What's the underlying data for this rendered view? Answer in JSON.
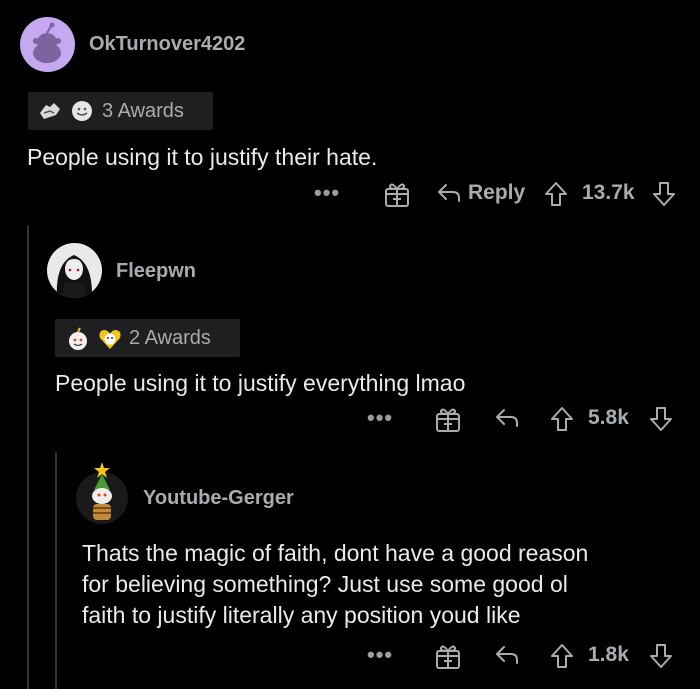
{
  "comments": [
    {
      "username": "OkTurnover4202",
      "awards_label": "3 Awards",
      "body": "People using it to justify their hate.",
      "reply_label": "Reply",
      "score": "13.7k",
      "more_label": "•••"
    },
    {
      "username": "Fleepwn",
      "awards_label": "2 Awards",
      "body": "People using it to justify everything lmao",
      "score": "5.8k",
      "more_label": "•••"
    },
    {
      "username": "Youtube-Gerger",
      "body_lines": [
        "Thats the magic of faith, dont have a good reason",
        "for believing something? Just use some good ol",
        "faith to justify literally any position youd like"
      ],
      "score": "1.8k",
      "more_label": "•••"
    }
  ],
  "colors": {
    "background": "#000000",
    "text": "#e8eaeb",
    "muted": "#a9acaf",
    "award_bg": "#1f1f21",
    "thread_line": "#343536",
    "avatar_purple": "#c5a8ef"
  },
  "icons": [
    "gift-icon",
    "reply-arrow-icon",
    "upvote-icon",
    "downvote-icon",
    "more-dots-icon",
    "award-icon"
  ]
}
